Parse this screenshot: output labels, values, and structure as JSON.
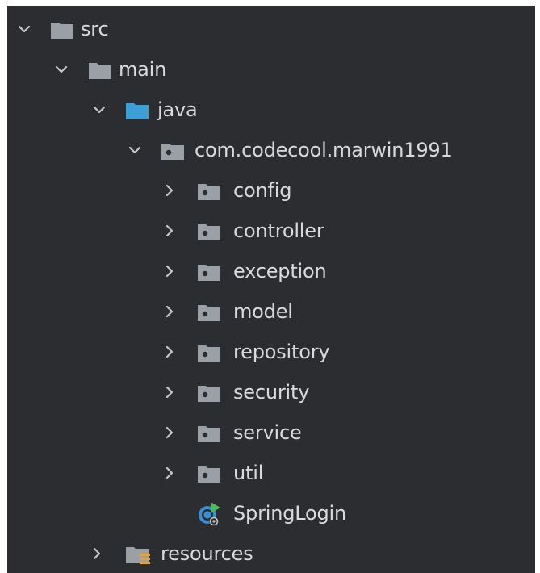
{
  "tree": {
    "src": {
      "label": "src",
      "expanded": true
    },
    "main": {
      "label": "main",
      "expanded": true
    },
    "java": {
      "label": "java",
      "expanded": true
    },
    "package": {
      "label": "com.codecool.marwin1991",
      "expanded": true
    },
    "children": [
      {
        "label": "config",
        "expanded": false
      },
      {
        "label": "controller",
        "expanded": false
      },
      {
        "label": "exception",
        "expanded": false
      },
      {
        "label": "model",
        "expanded": false
      },
      {
        "label": "repository",
        "expanded": false
      },
      {
        "label": "security",
        "expanded": false
      },
      {
        "label": "service",
        "expanded": false
      },
      {
        "label": "util",
        "expanded": false
      }
    ],
    "spring_class": {
      "label": "SpringLogin"
    },
    "resources": {
      "label": "resources",
      "expanded": false
    }
  },
  "colors": {
    "background": "#2b2d30",
    "text": "#d9dadc",
    "folder": "#9aa0a6",
    "source_folder": "#3d9fd6",
    "chevron": "#c4c7cc"
  }
}
